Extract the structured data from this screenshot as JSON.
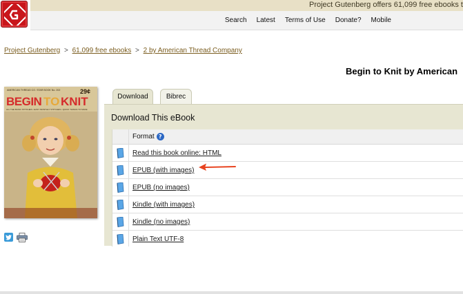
{
  "header": {
    "notice": "Project Gutenberg offers 61,099 free ebooks t",
    "nav": [
      "Search",
      "Latest",
      "Terms of Use",
      "Donate?",
      "Mobile"
    ]
  },
  "breadcrumb": {
    "items": [
      "Project Gutenberg",
      "61,099 free ebooks",
      "2 by American Thread Company"
    ],
    "separator": ">"
  },
  "page_title": "Begin to Knit by American",
  "cover": {
    "top_line": "AMERICAN THREAD CO. STAR BOOK No. 202",
    "price": "29¢",
    "title_left": "BEGIN",
    "title_mid": "TO",
    "title_right": "KNIT",
    "subtitle": "ALL THE BASIC STITCHES • EASY MONTHLY STITCHES • QUICK THINGS TO MAKE"
  },
  "tabs": [
    "Download",
    "Bibrec"
  ],
  "panel": {
    "title": "Download This eBook",
    "column_header": "Format",
    "help": "?",
    "rows": [
      "Read this book online: HTML",
      "EPUB (with images)",
      "EPUB (no images)",
      "Kindle (with images)",
      "Kindle (no images)",
      "Plain Text UTF-8"
    ]
  },
  "colors": {
    "accent_red": "#c8161b",
    "arrow": "#e8431f",
    "link_brown": "#7a5c1e",
    "panel_bg": "#e7e6d2"
  },
  "icons": {
    "logo": "project-gutenberg-logo",
    "format": "book-icon",
    "help": "help-icon",
    "twitter": "twitter-icon",
    "print": "print-icon"
  }
}
